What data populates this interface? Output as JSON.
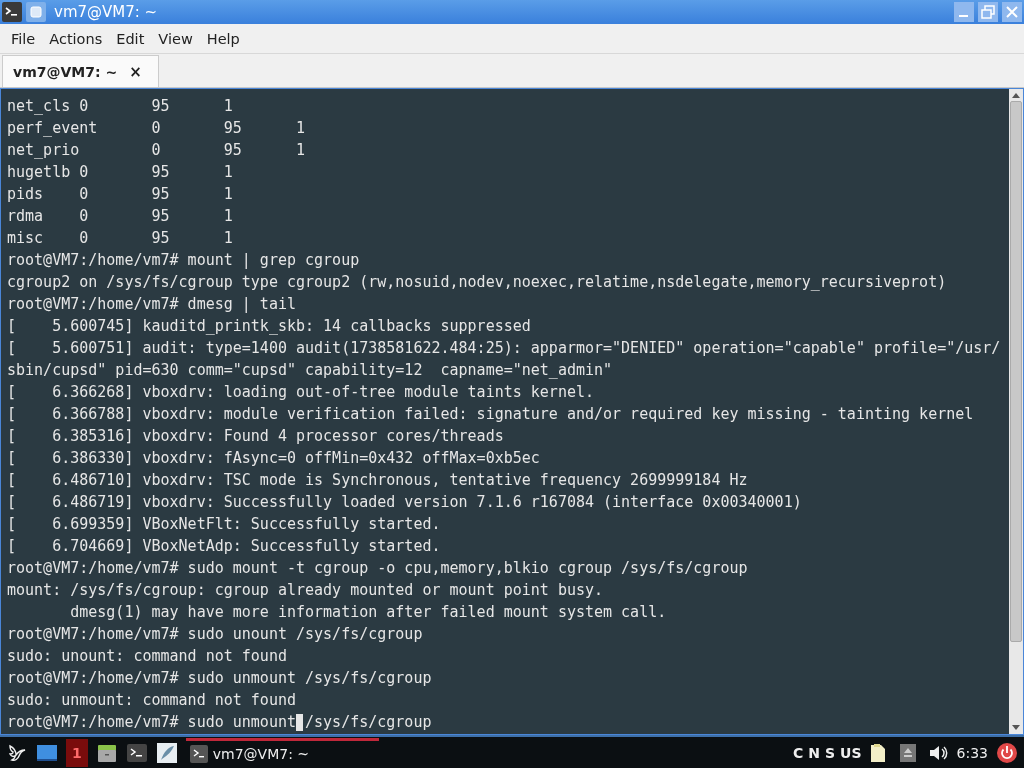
{
  "window": {
    "title": "vm7@VM7: ~"
  },
  "menu": [
    "File",
    "Actions",
    "Edit",
    "View",
    "Help"
  ],
  "tabs": [
    {
      "label": "vm7@VM7: ~",
      "close": "×",
      "selected": true
    }
  ],
  "terminal": {
    "lines": [
      {
        "text": "net_cls\t0\t95\t1"
      },
      {
        "text": "perf_event\t0\t95\t1"
      },
      {
        "text": "net_prio\t0\t95\t1"
      },
      {
        "text": "hugetlb\t0\t95\t1"
      },
      {
        "text": "pids\t0\t95\t1"
      },
      {
        "text": "rdma\t0\t95\t1"
      },
      {
        "text": "misc\t0\t95\t1"
      },
      {
        "text": "root@VM7:/home/vm7# mount | grep cgroup"
      },
      {
        "text": "cgroup2 on /sys/fs/cgroup type cgroup2 (rw,nosuid,nodev,noexec,relatime,nsdelegate,memory_recursiveprot)"
      },
      {
        "text": "root@VM7:/home/vm7# dmesg | tail"
      },
      {
        "text": "[    5.600745] kauditd_printk_skb: 14 callbacks suppressed"
      },
      {
        "text": "[    5.600751] audit: type=1400 audit(1738581622.484:25): apparmor=\"DENIED\" operation=\"capable\" profile=\"/usr/"
      },
      {
        "text": "sbin/cupsd\" pid=630 comm=\"cupsd\" capability=12  capname=\"net_admin\""
      },
      {
        "text": "[    6.366268] vboxdrv: loading out-of-tree module taints kernel."
      },
      {
        "text": "[    6.366788] vboxdrv: module verification failed: signature and/or required key missing - tainting kernel"
      },
      {
        "text": "[    6.385316] vboxdrv: Found 4 processor cores/threads"
      },
      {
        "text": "[    6.386330] vboxdrv: fAsync=0 offMin=0x432 offMax=0xb5ec"
      },
      {
        "text": "[    6.486710] vboxdrv: TSC mode is Synchronous, tentative frequency 2699999184 Hz"
      },
      {
        "text": "[    6.486719] vboxdrv: Successfully loaded version 7.1.6 r167084 (interface 0x00340001)"
      },
      {
        "text": "[    6.699359] VBoxNetFlt: Successfully started."
      },
      {
        "text": "[    6.704669] VBoxNetAdp: Successfully started."
      },
      {
        "text": "root@VM7:/home/vm7# sudo mount -t cgroup -o cpu,memory,blkio cgroup /sys/fs/cgroup"
      },
      {
        "text": "mount: /sys/fs/cgroup: cgroup already mounted or mount point busy."
      },
      {
        "text": "       dmesg(1) may have more information after failed mount system call."
      },
      {
        "text": "root@VM7:/home/vm7# sudo unount /sys/fs/cgroup"
      },
      {
        "text": "sudo: unount: command not found"
      },
      {
        "text": "root@VM7:/home/vm7# sudo unmount /sys/fs/cgroup"
      },
      {
        "text": "sudo: unmount: command not found"
      },
      {
        "text": "root@VM7:/home/vm7# sudo unmount",
        "rest": " /sys/fs/cgroup",
        "cursor": true
      }
    ]
  },
  "taskbar": {
    "workspace": "1",
    "task": {
      "label": "vm7@VM7: ~",
      "selected": true
    },
    "indicators": [
      "C",
      "N",
      "S",
      "US"
    ],
    "clock": "6:33"
  }
}
